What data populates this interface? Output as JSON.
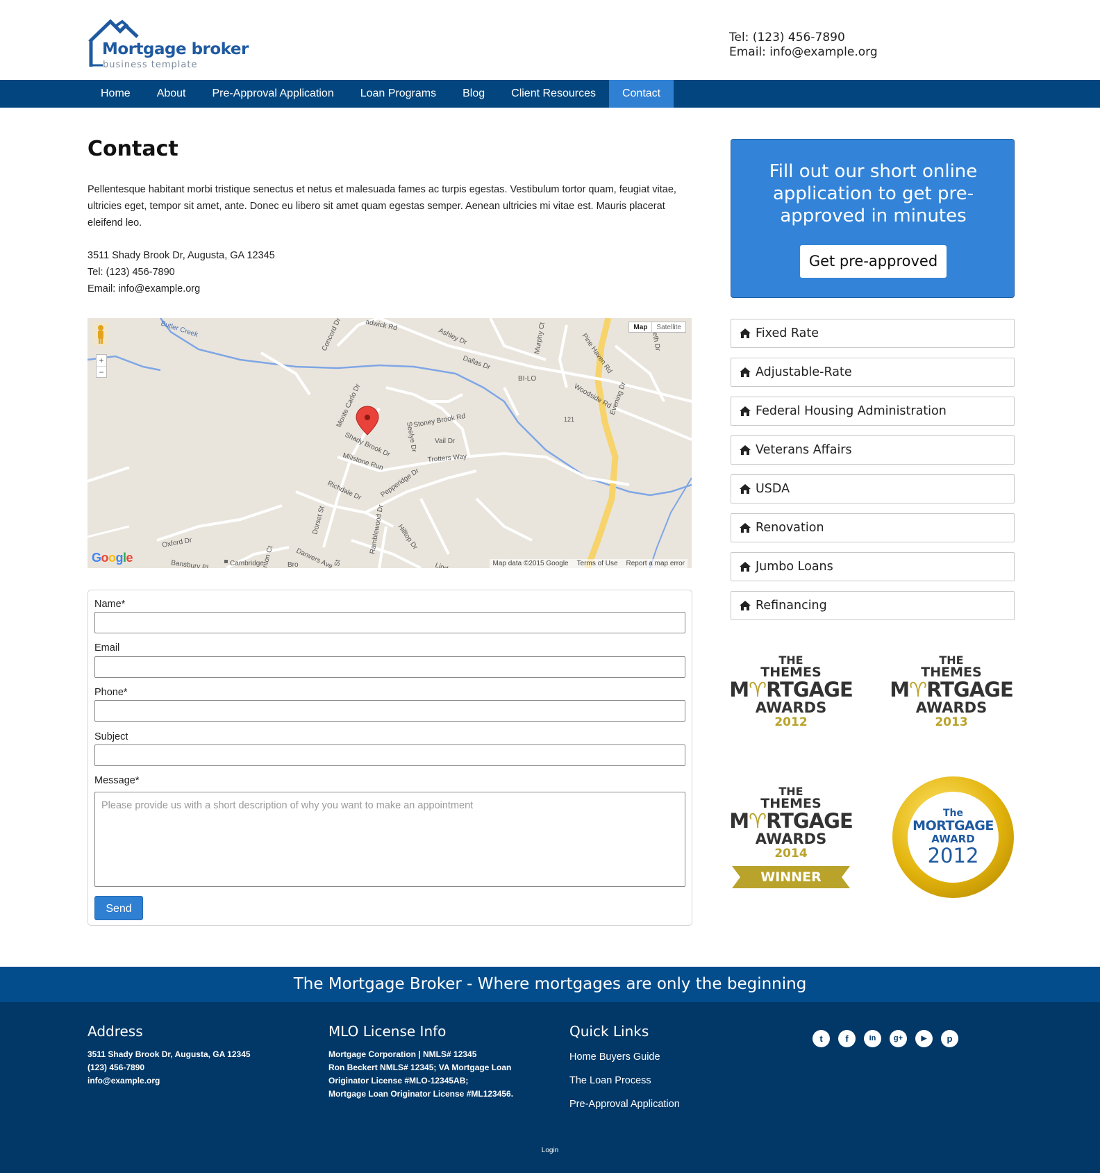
{
  "header": {
    "brand_name": "Mortgage broker",
    "brand_tagline": "business template",
    "phone": "Tel: (123) 456-7890",
    "email": "Email: info@example.org"
  },
  "nav": {
    "items": [
      {
        "label": "Home"
      },
      {
        "label": "About"
      },
      {
        "label": "Pre-Approval Application"
      },
      {
        "label": "Loan Programs"
      },
      {
        "label": "Blog"
      },
      {
        "label": "Client Resources"
      },
      {
        "label": "Contact",
        "active": true
      }
    ]
  },
  "main": {
    "title": "Contact",
    "intro": "Pellentesque habitant morbi tristique senectus et netus et malesuada fames ac turpis egestas. Vestibulum tortor quam, feugiat vitae, ultricies eget, tempor sit amet, ante. Donec eu libero sit amet quam egestas semper. Aenean ultricies mi vitae est. Mauris placerat eleifend leo.",
    "address": "3511 Shady Brook Dr, Augusta, GA 12345",
    "phone": "Tel: (123) 456-7890",
    "email": "Email: info@example.org"
  },
  "map": {
    "type_map": "Map",
    "type_satellite": "Satellite",
    "zoom_in": "+",
    "zoom_out": "−",
    "google_logo": "Google",
    "map_data": "Map data ©2015 Google",
    "terms": "Terms of Use",
    "report": "Report a map error",
    "labels": [
      "Butler Creek",
      "Concord Dr",
      "adwick Rd",
      "Ashley Dr",
      "Dallas Dr",
      "Murphy Ct",
      "BI-LO",
      "Pine Haven Rd",
      "abeth Dr",
      "Woodside Rd",
      "Evening Dr",
      "121",
      "Monte Carlo Dr",
      "Shady Brook Dr",
      "Stoney Brook Rd",
      "Seelye Dr",
      "Vail Dr",
      "Trotters Way",
      "Millstone Run",
      "Richdale Dr",
      "Pepperidge Dr",
      "Dorset St",
      "Ramblewood Dr",
      "Hilltop Dr",
      "Oxford Dr",
      "Bansbury Pl",
      "Cambridge",
      "nton Ct",
      "Danvers Ave",
      "Bro",
      "St",
      "Lind"
    ]
  },
  "form": {
    "name_label": "Name*",
    "email_label": "Email",
    "phone_label": "Phone*",
    "subject_label": "Subject",
    "message_label": "Message*",
    "message_placeholder": "Please provide us with a short description of why you want to make an appointment",
    "send_label": "Send"
  },
  "cta": {
    "text": "Fill out our short online application to get pre-approved in minutes",
    "button": "Get pre-approved"
  },
  "loan_programs": [
    {
      "label": "Fixed Rate",
      "icon": "home-icon"
    },
    {
      "label": "Adjustable-Rate",
      "icon": "home-icon"
    },
    {
      "label": "Federal Housing Administration",
      "icon": "home-icon"
    },
    {
      "label": "Veterans Affairs",
      "icon": "home-icon"
    },
    {
      "label": "USDA",
      "icon": "home-icon"
    },
    {
      "label": "Renovation",
      "icon": "home-icon"
    },
    {
      "label": "Jumbo Loans",
      "icon": "home-icon"
    },
    {
      "label": "Refinancing",
      "icon": "home-icon"
    }
  ],
  "awards": [
    {
      "the": "THE",
      "themes": "THEMES",
      "mort_m": "M",
      "mort_rest": "RTGAGE",
      "awards": "AWARDS",
      "year": "2012"
    },
    {
      "the": "THE",
      "themes": "THEMES",
      "mort_m": "M",
      "mort_rest": "RTGAGE",
      "awards": "AWARDS",
      "year": "2013"
    },
    {
      "the": "THE",
      "themes": "THEMES",
      "mort_m": "M",
      "mort_rest": "RTGAGE",
      "awards": "AWARDS",
      "year": "2014",
      "ribbon": "WINNER"
    }
  ],
  "medal": {
    "the": "The",
    "mortgage": "MORTGAGE",
    "award": "AWARD",
    "year": "2012"
  },
  "colors": {
    "nav": "#03467f",
    "nav_active": "#2f7fd3",
    "cta": "#3384d8",
    "footer": "#023867",
    "slogan_bar": "#034d8d",
    "gold": "#b9a32b"
  },
  "footer": {
    "slogan": "The Mortgage Broker - Where mortgages are only the beginning",
    "address_title": "Address",
    "address_lines": [
      "3511 Shady Brook Dr, Augusta, GA 12345",
      "(123) 456-7890",
      "info@example.org"
    ],
    "license_title": "MLO License Info",
    "license_lines": [
      "Mortgage Corporation | NMLS# 12345",
      "Ron Beckert NMLS# 12345; VA Mortgage Loan",
      "Originator License #MLO-12345AB;",
      "Mortgage Loan Originator License #ML123456."
    ],
    "links_title": "Quick Links",
    "links": [
      "Home Buyers Guide",
      "The Loan Process",
      "Pre-Approval Application"
    ],
    "social": [
      {
        "icon": "twitter-icon",
        "glyph": "t"
      },
      {
        "icon": "facebook-icon",
        "glyph": "f"
      },
      {
        "icon": "linkedin-icon",
        "glyph": "in"
      },
      {
        "icon": "google-plus-icon",
        "glyph": "g+"
      },
      {
        "icon": "youtube-icon",
        "glyph": "▶"
      },
      {
        "icon": "pinterest-icon",
        "glyph": "p"
      }
    ],
    "login": "Login"
  }
}
